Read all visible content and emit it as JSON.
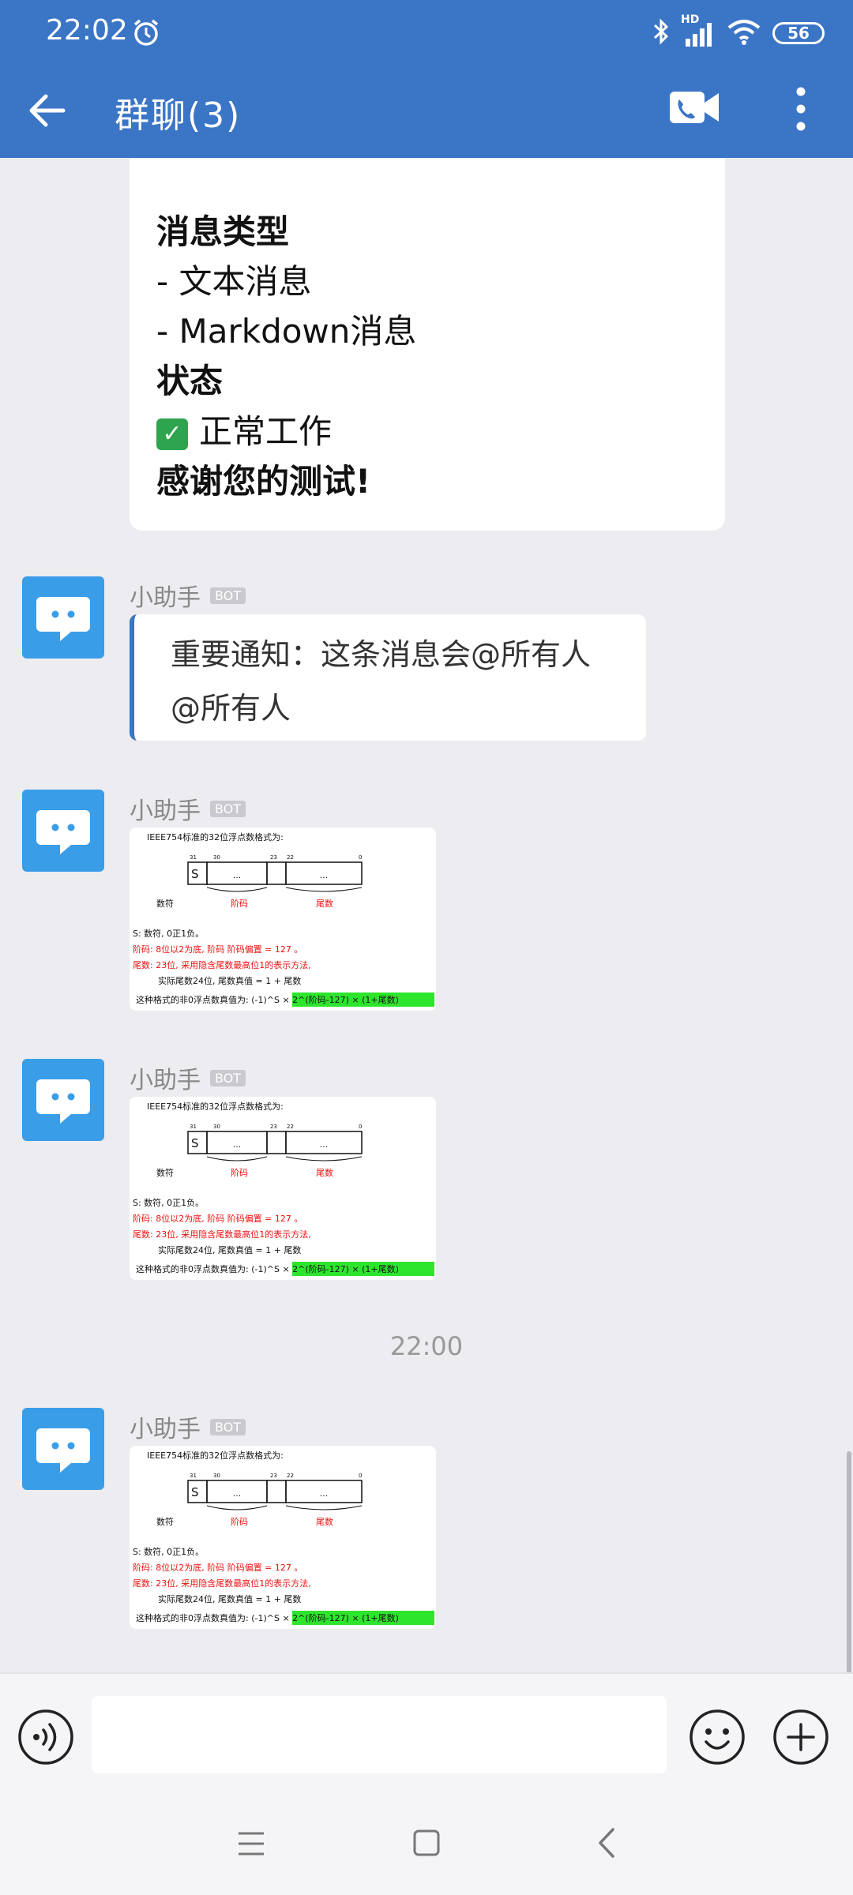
{
  "status_bar": {
    "time": "22:02",
    "network": "HD",
    "battery": "56"
  },
  "header": {
    "title": "群聊(3)"
  },
  "card_lines": [
    {
      "text": "消息类型",
      "bold": true
    },
    {
      "text": "- 文本消息",
      "bold": false
    },
    {
      "text": "- Markdown消息",
      "bold": false
    },
    {
      "text": "状态",
      "bold": true
    },
    {
      "text": "正常工作",
      "bold": false,
      "icon": "check-mark-icon"
    },
    {
      "text": "感谢您的测试!",
      "bold": true
    }
  ],
  "messages": [
    {
      "sender": "小助手",
      "badge": "BOT",
      "type": "notice",
      "lines": [
        "重要通知：这条消息会@所有人",
        "@所有人"
      ]
    },
    {
      "sender": "小助手",
      "badge": "BOT",
      "type": "image"
    },
    {
      "sender": "小助手",
      "badge": "BOT",
      "type": "image"
    },
    {
      "sender": "小助手",
      "badge": "BOT",
      "type": "image"
    }
  ],
  "time_divider": "22:00",
  "image_content": {
    "heading": "IEEE754标准的32位浮点数格式为:",
    "bit_labels": [
      "31",
      "30",
      "23",
      "22",
      "0"
    ],
    "cells": [
      "S",
      "...",
      "..."
    ],
    "field_labels": [
      "数符",
      "阶码",
      "尾数"
    ],
    "lines": [
      "S: 数符, 0正1负。",
      "阶码: 8位以2为底, 阶码 阶码偏置 = 127 。",
      "尾数: 23位, 采用隐含尾数最高位1的表示方法,",
      "实际尾数24位, 尾数真值 = 1 + 尾数",
      "这种格式的非0浮点数真值为: (-1)^S × 2^(阶码-127) × (1+尾数)"
    ]
  },
  "input": {
    "placeholder": ""
  },
  "colors": {
    "accent": "#3b75c6",
    "avatar": "#3a9de8",
    "chat_bg": "#ececf1"
  }
}
